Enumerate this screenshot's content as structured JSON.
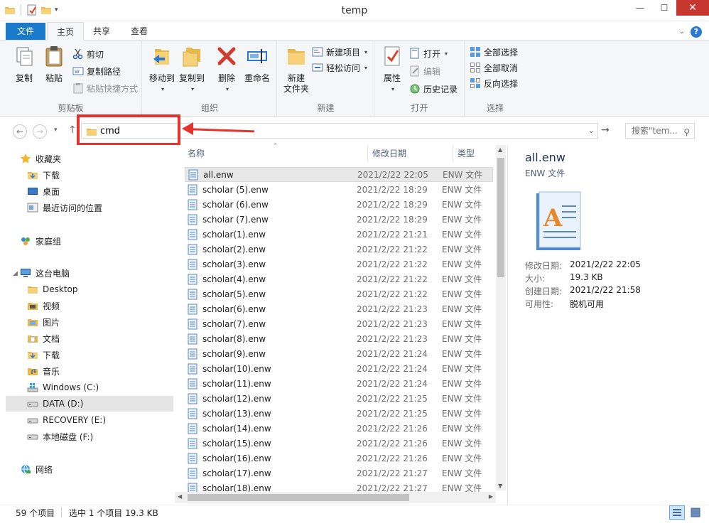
{
  "window": {
    "title": "temp"
  },
  "tabs": {
    "file": "文件",
    "home": "主页",
    "share": "共享",
    "view": "查看"
  },
  "ribbon": {
    "clipboard": {
      "label": "剪贴板",
      "copy": "复制",
      "paste": "粘贴",
      "cut": "剪切",
      "copy_path": "复制路径",
      "paste_shortcut": "粘贴快捷方式"
    },
    "organize": {
      "label": "组织",
      "move_to": "移动到",
      "copy_to": "复制到",
      "delete": "删除",
      "rename": "重命名"
    },
    "new": {
      "label": "新建",
      "new_folder_l1": "新建",
      "new_folder_l2": "文件夹",
      "new_item": "新建项目",
      "easy_access": "轻松访问"
    },
    "open": {
      "label": "打开",
      "properties": "属性",
      "open": "打开",
      "edit": "编辑",
      "history": "历史记录"
    },
    "select": {
      "label": "选择",
      "select_all": "全部选择",
      "select_none": "全部取消",
      "invert": "反向选择"
    }
  },
  "address": {
    "value": "cmd",
    "search_placeholder": "搜索\"tem..."
  },
  "nav": {
    "favorites": "收藏夹",
    "downloads": "下载",
    "desktop": "桌面",
    "recent": "最近访问的位置",
    "homegroup": "家庭组",
    "this_pc": "这台电脑",
    "pc_desktop": "Desktop",
    "videos": "视频",
    "pictures": "图片",
    "documents": "文档",
    "pc_downloads": "下载",
    "music": "音乐",
    "drive_c": "Windows (C:)",
    "drive_d": "DATA (D:)",
    "drive_e": "RECOVERY (E:)",
    "drive_f": "本地磁盘 (F:)",
    "network": "网络"
  },
  "columns": {
    "name": "名称",
    "date": "修改日期",
    "type": "类型"
  },
  "files": [
    {
      "name": "all.enw",
      "date": "2021/2/22 22:05",
      "type": "ENW 文件"
    },
    {
      "name": "scholar (5).enw",
      "date": "2021/2/22 18:29",
      "type": "ENW 文件"
    },
    {
      "name": "scholar (6).enw",
      "date": "2021/2/22 18:29",
      "type": "ENW 文件"
    },
    {
      "name": "scholar (7).enw",
      "date": "2021/2/22 18:29",
      "type": "ENW 文件"
    },
    {
      "name": "scholar(1).enw",
      "date": "2021/2/22 21:21",
      "type": "ENW 文件"
    },
    {
      "name": "scholar(2).enw",
      "date": "2021/2/22 21:22",
      "type": "ENW 文件"
    },
    {
      "name": "scholar(3).enw",
      "date": "2021/2/22 21:22",
      "type": "ENW 文件"
    },
    {
      "name": "scholar(4).enw",
      "date": "2021/2/22 21:22",
      "type": "ENW 文件"
    },
    {
      "name": "scholar(5).enw",
      "date": "2021/2/22 21:22",
      "type": "ENW 文件"
    },
    {
      "name": "scholar(6).enw",
      "date": "2021/2/22 21:23",
      "type": "ENW 文件"
    },
    {
      "name": "scholar(7).enw",
      "date": "2021/2/22 21:23",
      "type": "ENW 文件"
    },
    {
      "name": "scholar(8).enw",
      "date": "2021/2/22 21:23",
      "type": "ENW 文件"
    },
    {
      "name": "scholar(9).enw",
      "date": "2021/2/22 21:24",
      "type": "ENW 文件"
    },
    {
      "name": "scholar(10).enw",
      "date": "2021/2/22 21:24",
      "type": "ENW 文件"
    },
    {
      "name": "scholar(11).enw",
      "date": "2021/2/22 21:24",
      "type": "ENW 文件"
    },
    {
      "name": "scholar(12).enw",
      "date": "2021/2/22 21:25",
      "type": "ENW 文件"
    },
    {
      "name": "scholar(13).enw",
      "date": "2021/2/22 21:25",
      "type": "ENW 文件"
    },
    {
      "name": "scholar(14).enw",
      "date": "2021/2/22 21:26",
      "type": "ENW 文件"
    },
    {
      "name": "scholar(15).enw",
      "date": "2021/2/22 21:26",
      "type": "ENW 文件"
    },
    {
      "name": "scholar(16).enw",
      "date": "2021/2/22 21:26",
      "type": "ENW 文件"
    },
    {
      "name": "scholar(17).enw",
      "date": "2021/2/22 21:27",
      "type": "ENW 文件"
    },
    {
      "name": "scholar(18).enw",
      "date": "2021/2/22 21:27",
      "type": "ENW 文件"
    }
  ],
  "details": {
    "name": "all.enw",
    "type": "ENW 文件",
    "modified_label": "修改日期:",
    "modified": "2021/2/22 22:05",
    "size_label": "大小:",
    "size": "19.3 KB",
    "created_label": "创建日期:",
    "created": "2021/2/22 21:58",
    "availability_label": "可用性:",
    "availability": "脱机可用"
  },
  "status": {
    "count": "59 个项目",
    "selection": "选中 1 个项目  19.3 KB"
  },
  "colors": {
    "accent": "#1979ca",
    "annotation": "#e5322d",
    "close": "#c7372f"
  }
}
